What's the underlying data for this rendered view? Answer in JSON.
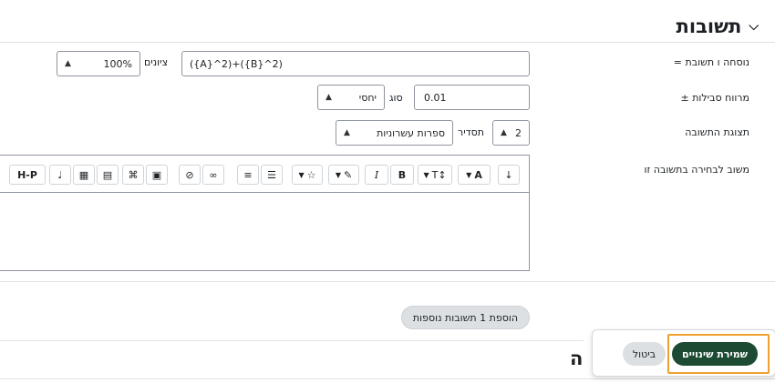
{
  "section": {
    "title": "תשובות"
  },
  "form": {
    "formula_label": "נוסחה ו תשובת =",
    "formula_value": "({A}^2)+({B}^2)",
    "grade_label": "ציונים",
    "grade_value": "100%",
    "tolerance_label": "מרווח סבילות ±",
    "tolerance_value": "0.01",
    "type_label": "סוג",
    "type_value": "יחסי",
    "display_label": "תצוגת התשובה",
    "display_value": "2",
    "format_label": "תסדיר",
    "format_value": "ספרות עשרוניות",
    "feedback_label": "משוב לבחירה בתשובה זו"
  },
  "toolbar": {
    "font_label": "A",
    "bold_label": "B",
    "italic_label": "I",
    "html_label": "H-P"
  },
  "add_answers_button": "הוספת 1 תשובות נוספות",
  "footer": {
    "save_label": "שמירת שינויים",
    "cancel_label": "ביטול",
    "partial_heading": "ה"
  }
}
